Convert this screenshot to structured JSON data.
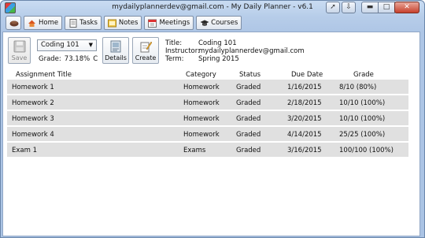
{
  "window": {
    "title": "mydailyplannerdev@gmail.com - My Daily Planner - v6.1"
  },
  "nav": {
    "items": [
      {
        "label": "Home",
        "icon": "house-icon"
      },
      {
        "label": "Tasks",
        "icon": "document-icon"
      },
      {
        "label": "Notes",
        "icon": "notes-icon"
      },
      {
        "label": "Meetings",
        "icon": "calendar-icon"
      },
      {
        "label": "Courses",
        "icon": "graduation-cap-icon"
      }
    ]
  },
  "course": {
    "selected": "Coding 101",
    "grade_label": "Grade:",
    "grade_percent": "73.18%",
    "grade_letter": "C"
  },
  "buttons": {
    "save": "Save",
    "details": "Details",
    "create": "Create"
  },
  "info": {
    "title_label": "Title:",
    "title_value": "Coding 101",
    "instructor_label": "Instructor:",
    "instructor_value": "mydailyplannerdev@gmail.com",
    "term_label": "Term:",
    "term_value": "Spring 2015"
  },
  "table": {
    "headers": [
      "Assignment Title",
      "Category",
      "Status",
      "Due Date",
      "Grade"
    ],
    "rows": [
      [
        "Homework 1",
        "Homework",
        "Graded",
        "1/16/2015",
        "8/10 (80%)"
      ],
      [
        "Homework 2",
        "Homework",
        "Graded",
        "2/18/2015",
        "10/10 (100%)"
      ],
      [
        "Homework 3",
        "Homework",
        "Graded",
        "3/20/2015",
        "10/10 (100%)"
      ],
      [
        "Homework 4",
        "Homework",
        "Graded",
        "4/14/2015",
        "25/25 (100%)"
      ],
      [
        "Exam 1",
        "Exams",
        "Graded",
        "3/16/2015",
        "100/100 (100%)"
      ]
    ]
  }
}
